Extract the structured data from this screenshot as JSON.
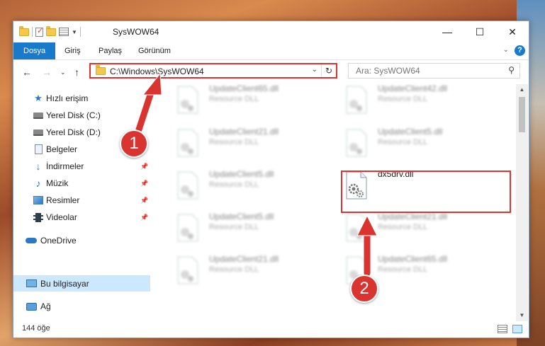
{
  "window": {
    "title": "SysWOW64",
    "controls": {
      "minimize": "—",
      "maximize": "☐",
      "close": "✕"
    }
  },
  "ribbon": {
    "tabs": [
      "Dosya",
      "Giriş",
      "Paylaş",
      "Görünüm"
    ],
    "help": "?"
  },
  "address": {
    "path": "C:\\Windows\\SysWOW64",
    "search_placeholder": "Ara: SysWOW64"
  },
  "nav": {
    "items": [
      {
        "label": "Hızlı erişim",
        "icon": "star-icon",
        "pinned": false
      },
      {
        "label": "Yerel Disk (C:)",
        "icon": "drive-icon",
        "pinned": false
      },
      {
        "label": "Yerel Disk (D:)",
        "icon": "drive-icon",
        "pinned": false
      },
      {
        "label": "Belgeler",
        "icon": "documents-icon",
        "pinned": false
      },
      {
        "label": "İndirmeler",
        "icon": "download-icon",
        "pinned": true
      },
      {
        "label": "Müzik",
        "icon": "music-icon",
        "pinned": true
      },
      {
        "label": "Resimler",
        "icon": "pictures-icon",
        "pinned": true
      },
      {
        "label": "Videolar",
        "icon": "videos-icon",
        "pinned": true
      },
      {
        "label": "OneDrive",
        "icon": "onedrive-icon",
        "pinned": false
      },
      {
        "label": "Bu bilgisayar",
        "icon": "this-pc-icon",
        "pinned": false,
        "selected": true
      },
      {
        "label": "Ağ",
        "icon": "network-icon",
        "pinned": false
      }
    ]
  },
  "files": [
    {
      "name": "UpdateClient65.dll",
      "type": "Resource DLL",
      "blurred": true
    },
    {
      "name": "UpdateClient42.dll",
      "type": "Resource DLL",
      "blurred": true
    },
    {
      "name": "UpdateClient21.dll",
      "type": "Resource DLL",
      "blurred": true
    },
    {
      "name": "UpdateClient5.dll",
      "type": "Resource DLL",
      "blurred": true
    },
    {
      "name": "UpdateClient5.dll",
      "type": "Resource DLL",
      "blurred": true
    },
    {
      "name": "dx5drv.dll",
      "type": "",
      "blurred": false,
      "highlighted": true
    },
    {
      "name": "UpdateClient5.dll",
      "type": "Resource DLL",
      "blurred": true
    },
    {
      "name": "UpdateClient21.dll",
      "type": "Resource DLL",
      "blurred": true
    },
    {
      "name": "UpdateClient21.dll",
      "type": "Resource DLL",
      "blurred": true
    },
    {
      "name": "UpdateClient65.dll",
      "type": "Resource DLL",
      "blurred": true
    }
  ],
  "status": {
    "item_count": "144 öğe"
  },
  "annotations": [
    {
      "number": "1",
      "color": "#d9342f"
    },
    {
      "number": "2",
      "color": "#d9342f"
    }
  ],
  "colors": {
    "accent": "#1979ca",
    "highlight": "#d9342f",
    "selection": "#cce8ff"
  }
}
